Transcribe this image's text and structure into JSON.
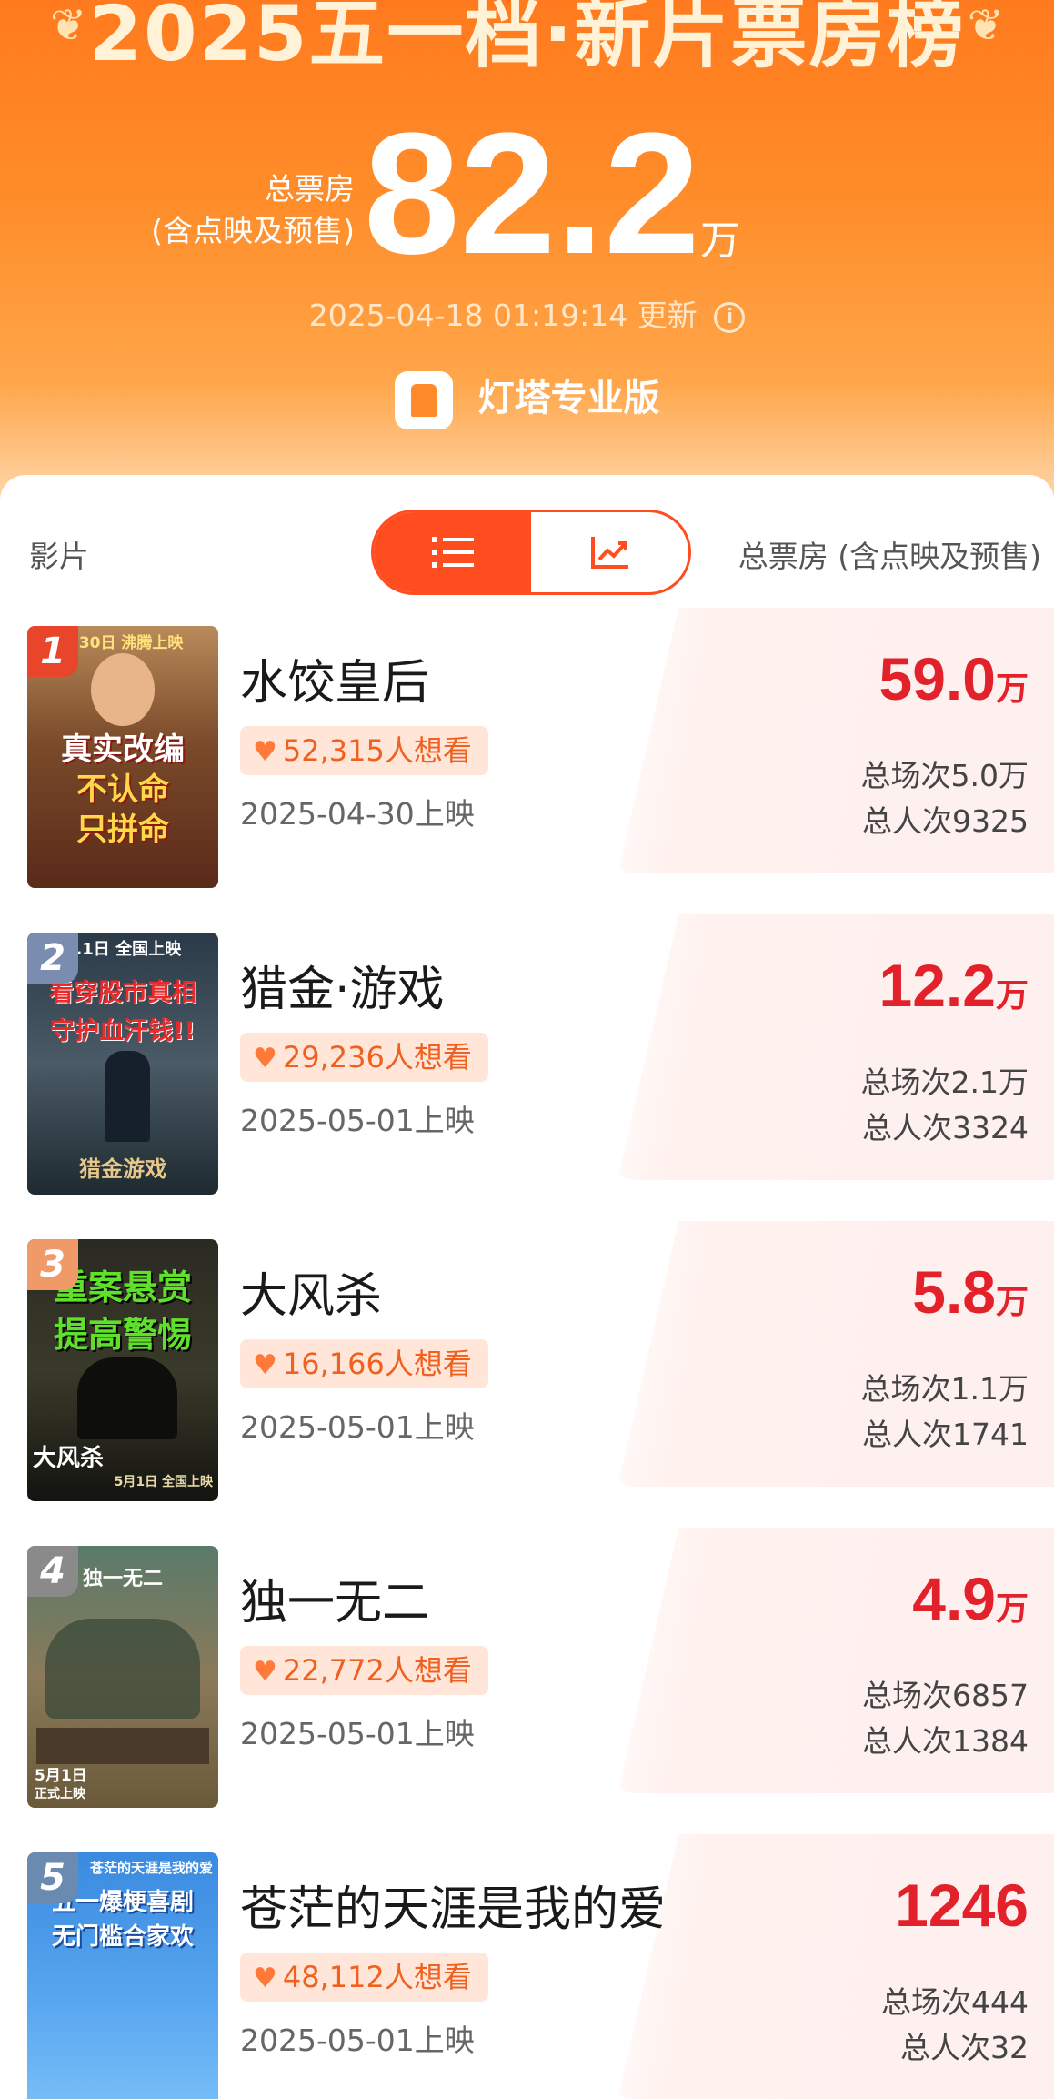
{
  "header": {
    "title": "2025五一档·新片票房榜",
    "total_label_line1": "总票房",
    "total_label_line2": "(含点映及预售)",
    "total_value": "82.2",
    "total_unit": "万",
    "update_time": "2025-04-18 01:19:14 更新",
    "brand": "灯塔专业版"
  },
  "table_header": {
    "film_label": "影片",
    "box_label": "总票房 (含点映及预售)",
    "view_toggle": [
      "list-icon",
      "trend-chart-icon"
    ],
    "active_view": "list"
  },
  "colors": {
    "accent": "#ff4d1f",
    "box_red": "#e3212a",
    "want_text": "#f0601f"
  },
  "films": [
    {
      "rank": "1",
      "title": "水饺皇后",
      "want": "52,315人想看",
      "release": "2025-04-30上映",
      "box_num": "59.0",
      "box_unit": "万",
      "screenings": "总场次5.0万",
      "admissions": "总人次9325",
      "poster_lines": [
        "4.30日 沸腾上映",
        "真实改编",
        "不认命",
        "只拼命"
      ]
    },
    {
      "rank": "2",
      "title": "猎金·游戏",
      "want": "29,236人想看",
      "release": "2025-05-01上映",
      "box_num": "12.2",
      "box_unit": "万",
      "screenings": "总场次2.1万",
      "admissions": "总人次3324",
      "poster_lines": [
        "5.1日 全国上映",
        "看穿股市真相",
        "守护血汗钱!!",
        "猎金游戏"
      ]
    },
    {
      "rank": "3",
      "title": "大风杀",
      "want": "16,166人想看",
      "release": "2025-05-01上映",
      "box_num": "5.8",
      "box_unit": "万",
      "screenings": "总场次1.1万",
      "admissions": "总人次1741",
      "poster_lines": [
        "重案悬赏",
        "提高警惕",
        "大风杀",
        "5月1日 全国上映"
      ]
    },
    {
      "rank": "4",
      "title": "独一无二",
      "want": "22,772人想看",
      "release": "2025-05-01上映",
      "box_num": "4.9",
      "box_unit": "万",
      "screenings": "总场次6857",
      "admissions": "总人次1384",
      "poster_lines": [
        "独一无二",
        "5月1日",
        "正式上映"
      ]
    },
    {
      "rank": "5",
      "title": "苍茫的天涯是我的爱",
      "want": "48,112人想看",
      "release": "2025-05-01上映",
      "box_num": "1246",
      "box_unit": "",
      "screenings": "总场次444",
      "admissions": "总人次32",
      "poster_lines": [
        "苍茫的天涯是我的爱",
        "五一爆梗喜剧",
        "无门槛合家欢"
      ]
    }
  ]
}
